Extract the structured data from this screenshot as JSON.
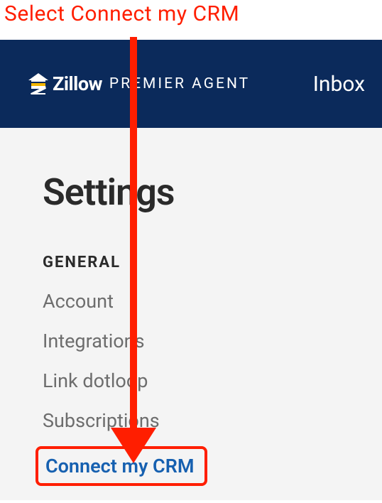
{
  "annotation": {
    "text": "Select Connect my CRM"
  },
  "header": {
    "brand_main": "Zillow",
    "brand_sub": "PREMIER AGENT",
    "inbox": "Inbox"
  },
  "page": {
    "title": "Settings",
    "section_label": "GENERAL",
    "nav": [
      {
        "label": "Account"
      },
      {
        "label": "Integrations"
      },
      {
        "label": "Link dotloop"
      },
      {
        "label": "Subscriptions"
      },
      {
        "label": "Connect my CRM"
      }
    ]
  }
}
